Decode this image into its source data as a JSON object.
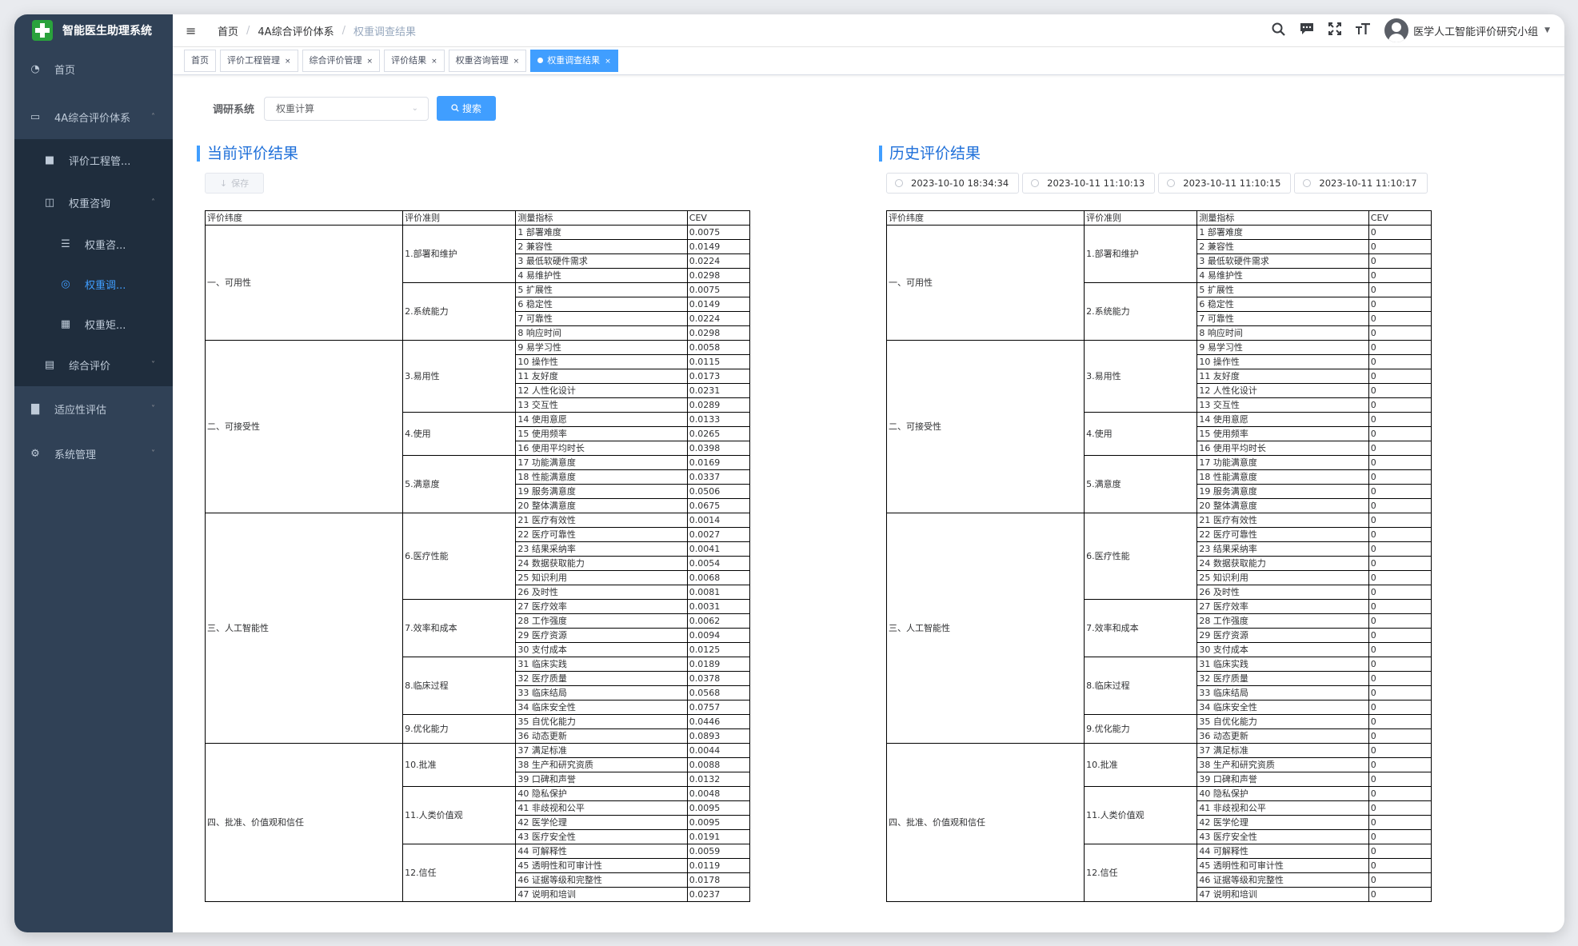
{
  "app": {
    "title": "智能医生助理系统"
  },
  "sidebar": {
    "items": [
      {
        "label": "首页",
        "icon": "dashboard-icon",
        "level": 1
      },
      {
        "label": "4A综合评价体系",
        "icon": "monitor-icon",
        "level": 1,
        "expanded": true
      },
      {
        "label": "评价工程管...",
        "icon": "folder-icon",
        "level": 2
      },
      {
        "label": "权重咨询",
        "icon": "table-icon",
        "level": 2,
        "expanded": true
      },
      {
        "label": "权重咨...",
        "icon": "list-icon",
        "level": 3
      },
      {
        "label": "权重调...",
        "icon": "target-icon",
        "level": 3,
        "active": true
      },
      {
        "label": "权重矩...",
        "icon": "grid-icon",
        "level": 3
      },
      {
        "label": "综合评价",
        "icon": "document-icon",
        "level": 2,
        "expanded": false
      },
      {
        "label": "适应性评估",
        "icon": "bar-chart-icon",
        "level": 1,
        "expanded": false
      },
      {
        "label": "系统管理",
        "icon": "gear-icon",
        "level": 1,
        "expanded": false
      }
    ]
  },
  "header": {
    "breadcrumb": [
      "首页",
      "4A综合评价体系",
      "权重调查结果"
    ],
    "user_name": "医学人工智能评价研究小组"
  },
  "tags": [
    {
      "label": "首页",
      "closable": false,
      "active": false
    },
    {
      "label": "评价工程管理",
      "closable": true,
      "active": false
    },
    {
      "label": "综合评价管理",
      "closable": true,
      "active": false
    },
    {
      "label": "评价结果",
      "closable": true,
      "active": false
    },
    {
      "label": "权重咨询管理",
      "closable": true,
      "active": false
    },
    {
      "label": "权重调查结果",
      "closable": true,
      "active": true
    }
  ],
  "search": {
    "label": "调研系统",
    "select_value": "权重计算",
    "button_label": "搜索"
  },
  "current": {
    "title": "当前评价结果",
    "save_label": "保存"
  },
  "history": {
    "title": "历史评价结果",
    "dates": [
      "2023-10-10 18:34:34",
      "2023-10-11 11:10:13",
      "2023-10-11 11:10:15",
      "2023-10-11 11:10:17"
    ]
  },
  "table": {
    "headers": [
      "评价纬度",
      "评价准则",
      "测量指标",
      "CEV"
    ],
    "dimensions": [
      {
        "label": "一、可用性",
        "criteria": [
          {
            "label": "1.部署和维护",
            "indicators": [
              {
                "name": "1 部署难度",
                "cev": "0.0075",
                "hist": "0"
              },
              {
                "name": "2 兼容性",
                "cev": "0.0149",
                "hist": "0"
              },
              {
                "name": "3 最低软硬件需求",
                "cev": "0.0224",
                "hist": "0"
              },
              {
                "name": "4 易维护性",
                "cev": "0.0298",
                "hist": "0"
              }
            ]
          },
          {
            "label": "2.系统能力",
            "indicators": [
              {
                "name": "5 扩展性",
                "cev": "0.0075",
                "hist": "0"
              },
              {
                "name": "6 稳定性",
                "cev": "0.0149",
                "hist": "0"
              },
              {
                "name": "7 可靠性",
                "cev": "0.0224",
                "hist": "0"
              },
              {
                "name": "8 响应时间",
                "cev": "0.0298",
                "hist": "0"
              }
            ]
          }
        ]
      },
      {
        "label": "二、可接受性",
        "criteria": [
          {
            "label": "3.易用性",
            "indicators": [
              {
                "name": "9 易学习性",
                "cev": "0.0058",
                "hist": "0"
              },
              {
                "name": "10 操作性",
                "cev": "0.0115",
                "hist": "0"
              },
              {
                "name": "11 友好度",
                "cev": "0.0173",
                "hist": "0"
              },
              {
                "name": "12 人性化设计",
                "cev": "0.0231",
                "hist": "0"
              },
              {
                "name": "13 交互性",
                "cev": "0.0289",
                "hist": "0"
              }
            ]
          },
          {
            "label": "4.使用",
            "indicators": [
              {
                "name": "14 使用意愿",
                "cev": "0.0133",
                "hist": "0"
              },
              {
                "name": "15 使用频率",
                "cev": "0.0265",
                "hist": "0"
              },
              {
                "name": "16 使用平均时长",
                "cev": "0.0398",
                "hist": "0"
              }
            ]
          },
          {
            "label": "5.满意度",
            "indicators": [
              {
                "name": "17 功能满意度",
                "cev": "0.0169",
                "hist": "0"
              },
              {
                "name": "18 性能满意度",
                "cev": "0.0337",
                "hist": "0"
              },
              {
                "name": "19 服务满意度",
                "cev": "0.0506",
                "hist": "0"
              },
              {
                "name": "20 整体满意度",
                "cev": "0.0675",
                "hist": "0"
              }
            ]
          }
        ]
      },
      {
        "label": "三、人工智能性",
        "criteria": [
          {
            "label": "6.医疗性能",
            "indicators": [
              {
                "name": "21 医疗有效性",
                "cev": "0.0014",
                "hist": "0"
              },
              {
                "name": "22 医疗可靠性",
                "cev": "0.0027",
                "hist": "0"
              },
              {
                "name": "23 结果采纳率",
                "cev": "0.0041",
                "hist": "0"
              },
              {
                "name": "24 数据获取能力",
                "cev": "0.0054",
                "hist": "0"
              },
              {
                "name": "25 知识利用",
                "cev": "0.0068",
                "hist": "0"
              },
              {
                "name": "26 及时性",
                "cev": "0.0081",
                "hist": "0"
              }
            ]
          },
          {
            "label": "7.效率和成本",
            "indicators": [
              {
                "name": "27 医疗效率",
                "cev": "0.0031",
                "hist": "0"
              },
              {
                "name": "28 工作强度",
                "cev": "0.0062",
                "hist": "0"
              },
              {
                "name": "29 医疗资源",
                "cev": "0.0094",
                "hist": "0"
              },
              {
                "name": "30 支付成本",
                "cev": "0.0125",
                "hist": "0"
              }
            ]
          },
          {
            "label": "8.临床过程",
            "indicators": [
              {
                "name": "31 临床实践",
                "cev": "0.0189",
                "hist": "0"
              },
              {
                "name": "32 医疗质量",
                "cev": "0.0378",
                "hist": "0"
              },
              {
                "name": "33 临床结局",
                "cev": "0.0568",
                "hist": "0"
              },
              {
                "name": "34 临床安全性",
                "cev": "0.0757",
                "hist": "0"
              }
            ]
          },
          {
            "label": "9.优化能力",
            "indicators": [
              {
                "name": "35 自优化能力",
                "cev": "0.0446",
                "hist": "0"
              },
              {
                "name": "36 动态更新",
                "cev": "0.0893",
                "hist": "0"
              }
            ]
          }
        ]
      },
      {
        "label": "四、批准、价值观和信任",
        "criteria": [
          {
            "label": "10.批准",
            "indicators": [
              {
                "name": "37 满足标准",
                "cev": "0.0044",
                "hist": "0"
              },
              {
                "name": "38 生产和研究资质",
                "cev": "0.0088",
                "hist": "0"
              },
              {
                "name": "39 口碑和声誉",
                "cev": "0.0132",
                "hist": "0"
              }
            ]
          },
          {
            "label": "11.人类价值观",
            "indicators": [
              {
                "name": "40 隐私保护",
                "cev": "0.0048",
                "hist": "0"
              },
              {
                "name": "41 非歧视和公平",
                "cev": "0.0095",
                "hist": "0"
              },
              {
                "name": "42 医学伦理",
                "cev": "0.0095",
                "hist": "0"
              },
              {
                "name": "43 医疗安全性",
                "cev": "0.0191",
                "hist": "0"
              }
            ]
          },
          {
            "label": "12.信任",
            "indicators": [
              {
                "name": "44 可解释性",
                "cev": "0.0059",
                "hist": "0"
              },
              {
                "name": "45 透明性和可审计性",
                "cev": "0.0119",
                "hist": "0"
              },
              {
                "name": "46 证据等级和完整性",
                "cev": "0.0178",
                "hist": "0"
              },
              {
                "name": "47 说明和培训",
                "cev": "0.0237",
                "hist": "0"
              }
            ]
          }
        ]
      }
    ]
  }
}
